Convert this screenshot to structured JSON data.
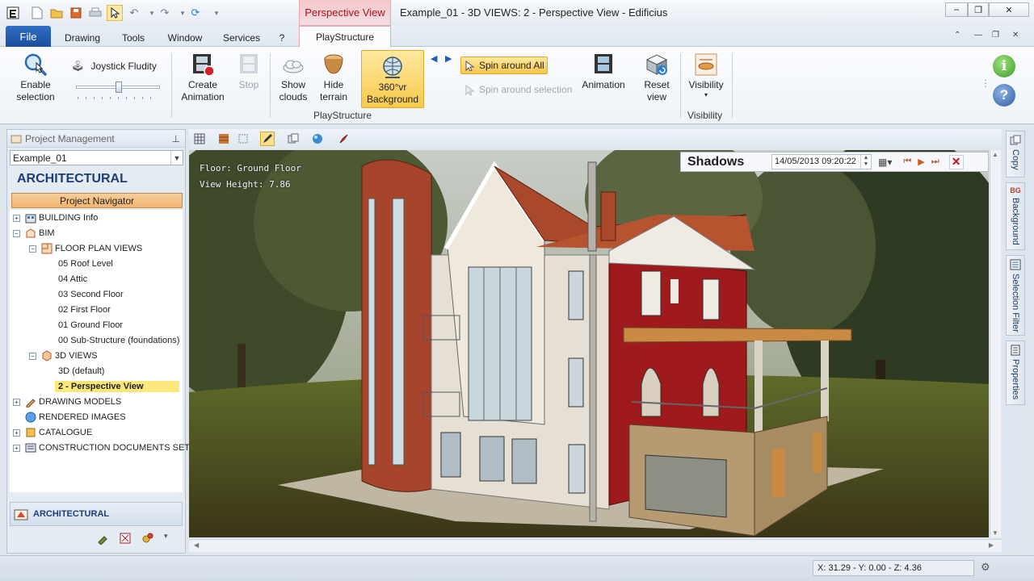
{
  "titlebar": {
    "context_tab": "Perspective View",
    "window_title": "Example_01 - 3D VIEWS: 2 - Perspective View - Edificius"
  },
  "tabs": [
    "File",
    "Drawing",
    "Tools",
    "Window",
    "Services",
    "?",
    "PlayStructure"
  ],
  "ribbon": {
    "enable_selection": [
      "Enable",
      "selection"
    ],
    "joystick": "Joystick Fludity",
    "create_animation": [
      "Create",
      "Animation"
    ],
    "stop": "Stop",
    "show_clouds": [
      "Show",
      "clouds"
    ],
    "hide_terrain": [
      "Hide",
      "terrain"
    ],
    "background_360": [
      "360°vr",
      "Background"
    ],
    "spin_all": "Spin around All",
    "spin_selection": "Spin around selection",
    "animation": "Animation",
    "reset_view": [
      "Reset",
      "view"
    ],
    "visibility": "Visibility",
    "group_playstructure": "PlayStructure",
    "group_visibility": "Visibility"
  },
  "left_panel": {
    "header": "Project Management",
    "combo_value": "Example_01",
    "section_title": "ARCHITECTURAL",
    "navigator": "Project Navigator",
    "tree": [
      {
        "label": "BUILDING Info"
      },
      {
        "label": "BIM"
      },
      {
        "label": "FLOOR PLAN VIEWS"
      },
      {
        "label": "05 Roof Level"
      },
      {
        "label": "04 Attic"
      },
      {
        "label": "03 Second Floor"
      },
      {
        "label": "02 First Floor"
      },
      {
        "label": "01 Ground Floor"
      },
      {
        "label": "00 Sub-Structure (foundations)"
      },
      {
        "label": "3D VIEWS"
      },
      {
        "label": "3D (default)"
      },
      {
        "label": "2 - Perspective View"
      },
      {
        "label": "DRAWING MODELS"
      },
      {
        "label": "RENDERED IMAGES"
      },
      {
        "label": "CATALOGUE"
      },
      {
        "label": "CONSTRUCTION DOCUMENTS SET"
      }
    ],
    "footer_label": "ARCHITECTURAL"
  },
  "viewport": {
    "floor_text": "Floor: Ground Floor",
    "height_text": "View Height: 7.86"
  },
  "shadows": {
    "title": "Shadows",
    "datetime": "14/05/2013 09:20:22"
  },
  "side_tabs": [
    "Copy",
    "Background",
    "Selection Filter",
    "Properties"
  ],
  "status": {
    "coords": "X: 31.29 - Y: 0.00 - Z: 4.36"
  },
  "colors": {
    "accent": "#1c4f9e",
    "context_tab": "#b00e1f",
    "highlight": "#fbe87a",
    "navigator": "#f0b470"
  }
}
